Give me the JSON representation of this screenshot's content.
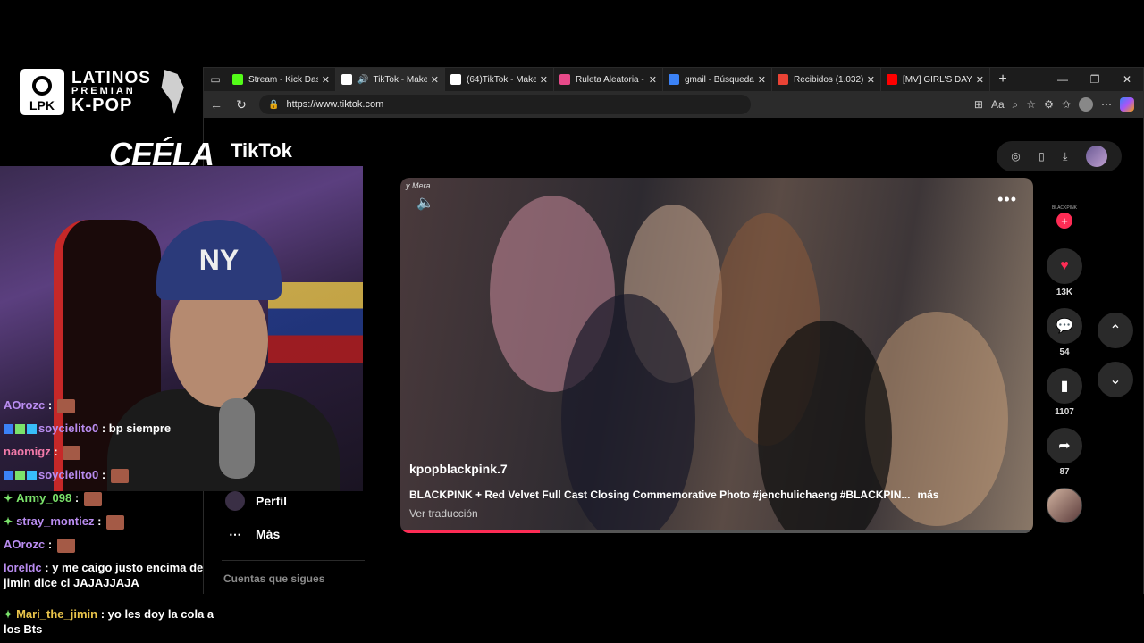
{
  "browser": {
    "tabs": [
      {
        "label": "Stream - Kick Dash",
        "icon": "kick-icon",
        "color": "#53fc18"
      },
      {
        "label": "TikTok - Make",
        "icon": "tiktok-icon",
        "color": "#ffffff"
      },
      {
        "label": "(64)TikTok - Make",
        "icon": "tiktok-icon",
        "color": "#ffffff"
      },
      {
        "label": "Ruleta Aleatoria -",
        "icon": "roulette-icon",
        "color": "#e84a8a"
      },
      {
        "label": "gmail - Búsqueda",
        "icon": "search-icon",
        "color": "#3b82f6"
      },
      {
        "label": "Recibidos (1.032)",
        "icon": "gmail-icon",
        "color": "#ea4335"
      },
      {
        "label": "[MV] GIRL'S DAY(",
        "icon": "youtube-icon",
        "color": "#ff0000"
      }
    ],
    "url": "https://www.tiktok.com"
  },
  "tiktok": {
    "logo": "TikTok",
    "menu": {
      "profile": "Perfil",
      "more": "Más",
      "following_accounts": "Cuentas que sigues"
    },
    "video": {
      "watermark": "y Mera",
      "author": "kpopblackpink.7",
      "description": "BLACKPINK + Red Velvet Full Cast Closing Commemorative Photo #jenchulichaeng #BLACKPIN...",
      "more": "más",
      "translate": "Ver traducción",
      "progress": 0.22
    },
    "actions": {
      "brand": "BLACKPINK",
      "likes": "13K",
      "comments": "54",
      "saves": "1107",
      "shares": "87"
    }
  },
  "overlay": {
    "logo": {
      "badge": "LPK",
      "line1": "LATINOS",
      "line2": "PREMIAN",
      "line3": "K-POP"
    },
    "streamer": "CEÉLA"
  },
  "chat": [
    {
      "user": "AOrozc",
      "color": "#b98cf0",
      "text": "",
      "badges": [],
      "emote": true
    },
    {
      "user": "soycielito0",
      "color": "#b98cf0",
      "text": "bp siempre",
      "badges": [
        "#3b82f6",
        "#7be36b",
        "#38bdf8"
      ],
      "emote": false
    },
    {
      "user": "naomigz",
      "color": "#f27aa9",
      "text": "",
      "badges": [],
      "emote": true
    },
    {
      "user": "soycielito0",
      "color": "#b98cf0",
      "text": "",
      "badges": [
        "#3b82f6",
        "#7be36b",
        "#38bdf8"
      ],
      "emote": true
    },
    {
      "user": "Army_098",
      "color": "#7be36b",
      "text": "",
      "badges": [
        "diamond"
      ],
      "emote": true
    },
    {
      "user": "stray_montiez",
      "color": "#b98cf0",
      "text": "",
      "badges": [
        "diamond"
      ],
      "emote": true
    },
    {
      "user": "AOrozc",
      "color": "#b98cf0",
      "text": "",
      "badges": [],
      "emote": true
    },
    {
      "user": "loreldc",
      "color": "#b98cf0",
      "text": "y me caigo justo encima de jimin dice cl JAJAJJAJA",
      "badges": [],
      "emote": false
    },
    {
      "user": "Mari_the_jimin",
      "color": "#e9c44a",
      "text": "yo les doy la cola a los Bts",
      "badges": [
        "diamond"
      ],
      "emote": false
    }
  ]
}
